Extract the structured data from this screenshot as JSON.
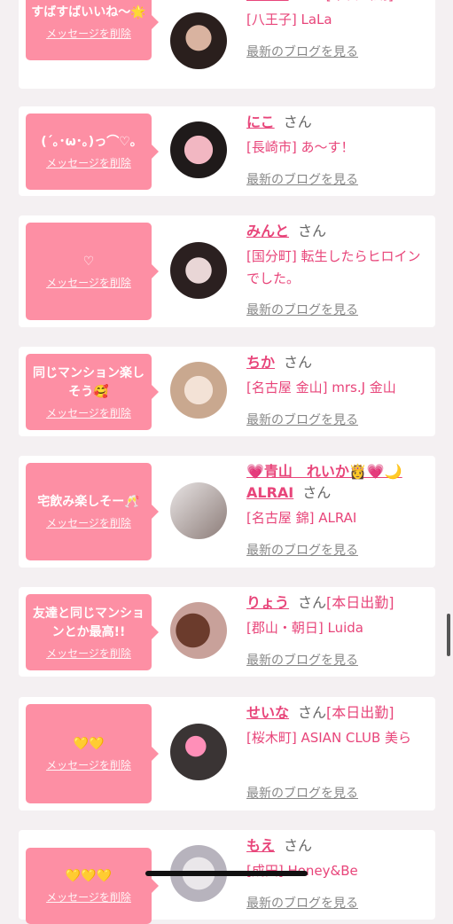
{
  "delete_label": "メッセージを削除",
  "san_label": "さん",
  "blog_label": "最新のブログを見る",
  "cards": [
    {
      "message": "すばすばいいね〜🌟",
      "name": "かえで",
      "status": "[本日出勤]",
      "shop": "[八王子] LaLa"
    },
    {
      "message": "(´｡･ω･｡)っ⌒♡｡",
      "name": "にこ",
      "status": "",
      "shop": "[長崎市] あ〜す！"
    },
    {
      "message": "♡",
      "name": "みんと",
      "status": "",
      "shop": "[国分町] 転生したらヒロインでした。"
    },
    {
      "message": "同じマンション楽しそう🥰",
      "name": "ちか",
      "status": "",
      "shop": "[名古屋 金山] mrs.J 金山"
    },
    {
      "message": "宅飲み楽しそー🥂",
      "name": "💗青山　れいか👸💗🌙ALRAI",
      "status": "",
      "shop": "[名古屋 錦] ALRAI"
    },
    {
      "message": "友達と同じマンションとか最高!!",
      "name": "りょう",
      "status": "[本日出勤]",
      "shop": "[郡山・朝日] Luida"
    },
    {
      "message": "💛💛",
      "name": "せいな",
      "status": "[本日出勤]",
      "shop": "[桜木町] ASIAN CLUB 美ら"
    },
    {
      "message": "💛💛💛",
      "name": "もえ",
      "status": "",
      "shop": "[成田] Honey&Be"
    }
  ],
  "colors": {
    "accent": "#e8457a",
    "bubble": "#fd8fa4",
    "background": "#f4f0f2"
  }
}
